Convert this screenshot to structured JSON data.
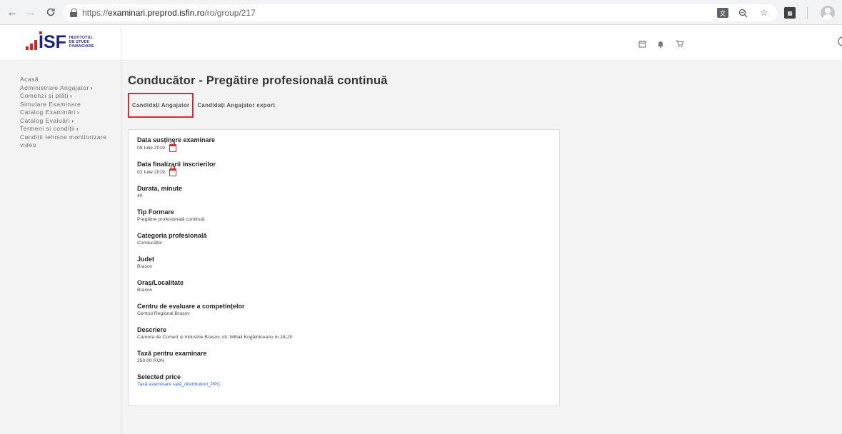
{
  "browser": {
    "url_scheme": "https://",
    "url_host": "examinari.preprod.isfin.ro",
    "url_path": "/ro/group/217",
    "back_icon": "←",
    "forward_icon": "→",
    "reload_icon": "C",
    "zoom_icon": "⊖",
    "star_icon": "☆"
  },
  "header": {
    "logo_main": "ISF",
    "logo_line1": "INSTITUTUL",
    "logo_line2": "DE STUDII",
    "logo_line3": "FINANCIARE",
    "icons": [
      "calendar-icon",
      "bell-icon",
      "cart-icon"
    ]
  },
  "sidebar": {
    "items": [
      {
        "label": "Acasă",
        "has_chevron": false
      },
      {
        "label": "Administrare Angajator",
        "has_chevron": true
      },
      {
        "label": "Comenzi și plăți",
        "has_chevron": true
      },
      {
        "label": "Simulare Examinare",
        "has_chevron": false
      },
      {
        "label": "Catalog Examinări",
        "has_chevron": true
      },
      {
        "label": "Catalog Evaluări",
        "has_chevron": true
      },
      {
        "label": "Termeni si condiții",
        "has_chevron": true
      },
      {
        "label": "Conditii tehnice monitorizare video",
        "has_chevron": false
      }
    ],
    "chevron": "›"
  },
  "main": {
    "title": "Conducător - Pregătire profesională continuă",
    "tabs": [
      {
        "label": "Candidați Angajator",
        "active": true
      },
      {
        "label": "Candidați Angajator export",
        "active": false
      }
    ],
    "fields": [
      {
        "label": "Data susținere examinare",
        "value": "09 Iulie 2019"
      },
      {
        "label": "Data finalizarii inscrierilor",
        "value": "02 Iulie 2019"
      },
      {
        "label": "Durata, minute",
        "value": "40"
      },
      {
        "label": "Tip Formare",
        "value": "Pregătire profesională continuă"
      },
      {
        "label": "Categoria profesională",
        "value": "Conducător"
      },
      {
        "label": "Judet",
        "value": "Brasov"
      },
      {
        "label": "Oraș/Localitate",
        "value": "Brasov"
      },
      {
        "label": "Centru de evaluare a competințelor",
        "value": "Centrul Regional Brașov"
      },
      {
        "label": "Descriere",
        "value": "Camera de Comerț și Industrie Brașov, str. Mihail Kogălniceanu nr.18-20"
      },
      {
        "label": "Taxă pentru examinare",
        "value": "250,00 RON"
      },
      {
        "label": "Selected price",
        "value": "Taxă examinare sală_distribuitori_PPC"
      }
    ]
  },
  "colors": {
    "accent_red": "#d32f2f",
    "logo_blue": "#1a237e",
    "link_blue": "#2962ff"
  }
}
